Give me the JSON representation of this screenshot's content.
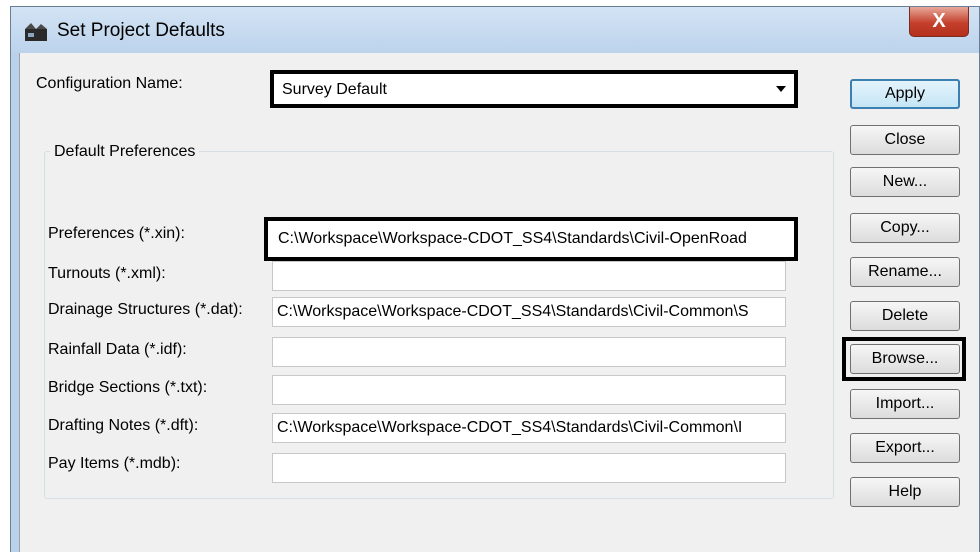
{
  "window": {
    "title": "Set Project Defaults",
    "close_label": "X"
  },
  "configuration": {
    "label": "Configuration Name:",
    "value": "Survey Default"
  },
  "group": {
    "title": "Default Preferences"
  },
  "fields": [
    {
      "label": "Preferences (*.xin):",
      "value": "C:\\Workspace\\Workspace-CDOT_SS4\\Standards\\Civil-OpenRoad"
    },
    {
      "label": "Turnouts (*.xml):",
      "value": ""
    },
    {
      "label": "Drainage Structures (*.dat):",
      "value": "C:\\Workspace\\Workspace-CDOT_SS4\\Standards\\Civil-Common\\S"
    },
    {
      "label": "Rainfall Data (*.idf):",
      "value": ""
    },
    {
      "label": "Bridge Sections (*.txt):",
      "value": ""
    },
    {
      "label": "Drafting Notes (*.dft):",
      "value": "C:\\Workspace\\Workspace-CDOT_SS4\\Standards\\Civil-Common\\I"
    },
    {
      "label": "Pay Items (*.mdb):",
      "value": ""
    }
  ],
  "buttons": {
    "apply": "Apply",
    "close": "Close",
    "new": "New...",
    "copy": "Copy...",
    "rename": "Rename...",
    "delete": "Delete",
    "browse": "Browse...",
    "import": "Import...",
    "export": "Export...",
    "help": "Help"
  }
}
